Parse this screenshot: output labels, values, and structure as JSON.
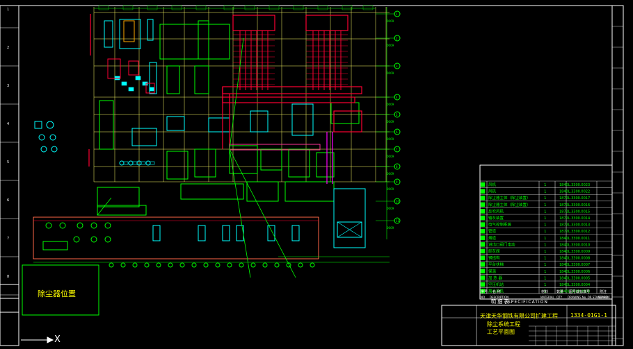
{
  "drawing": {
    "background": "#000000",
    "colors": {
      "frame": "#ffffff",
      "grid_line": "#ffff66",
      "column_bubble": "#00ff00",
      "equipment_cyan": "#00ffff",
      "equipment_green": "#00ff00",
      "piping_red": "#ff0033",
      "magenta": "#ff00ff",
      "leader": "#00ff00"
    }
  },
  "column_axes": {
    "right_bubbles": [
      "1",
      "2",
      "3",
      "4",
      "5",
      "6",
      "7",
      "8",
      "9",
      "10",
      "11"
    ],
    "left_strip_marks": [
      "1",
      "2",
      "3",
      "4",
      "5",
      "6",
      "7",
      "8"
    ]
  },
  "dust_remover_box": {
    "label": "除尘器位置"
  },
  "axis_indicator": {
    "label": "X"
  },
  "equipment_list": {
    "rows": [
      {
        "no": "17",
        "name": "风机",
        "qty": "1",
        "code": "1840L.3300.0023"
      },
      {
        "no": "16",
        "name": "风机",
        "qty": "1",
        "code": "1840L.3300.0022"
      },
      {
        "no": "15",
        "name": "除尘器主体（除尘装置）",
        "qty": "1",
        "code": "1872L.3300.0017"
      },
      {
        "no": "14",
        "name": "除尘器主体（除尘装置）",
        "qty": "1",
        "code": "1872L.3300.0016"
      },
      {
        "no": "13",
        "name": "反吹风机",
        "qty": "1",
        "code": "1872L.3300.0015"
      },
      {
        "no": "12",
        "name": "输灰装置",
        "qty": "1",
        "code": "1872L.3300.0014"
      },
      {
        "no": "11",
        "name": "电气控制系统",
        "qty": "1",
        "code": "1872L.3300.0013"
      },
      {
        "no": "10",
        "name": "管道",
        "qty": "1",
        "code": "1872L.3300.0012"
      },
      {
        "no": "9",
        "name": "烟道",
        "qty": "1",
        "code": "1840L.3300.0011"
      },
      {
        "no": "8",
        "name": "进出口阀门电动",
        "qty": "1",
        "code": "1840L.3300.0010"
      },
      {
        "no": "7",
        "name": "卸灰阀",
        "qty": "1",
        "code": "1840L.3300.0009"
      },
      {
        "no": "6",
        "name": "钢结构",
        "qty": "1",
        "code": "1840L.3300.0008"
      },
      {
        "no": "5",
        "name": "平台扶梯",
        "qty": "1",
        "code": "1840L.3300.0007"
      },
      {
        "no": "4",
        "name": "保温",
        "qty": "1",
        "code": "1840L.3300.0006"
      },
      {
        "no": "3",
        "name": "加 热 器",
        "qty": "1",
        "code": "1840L.3300.0005"
      },
      {
        "no": "2",
        "name": "空压机站",
        "qty": "1",
        "code": "1840L.3300.0004"
      },
      {
        "no": "1",
        "name": "离心风机",
        "qty": "1",
        "code": "1840L.3300.0003"
      }
    ],
    "header_cn": [
      "序号",
      "名 称",
      "材料",
      "数量",
      "图号或标准号",
      "附注"
    ],
    "header_en": [
      "NO",
      "DESCRIPTION",
      "MATERIAL",
      "QTY",
      "DRAWING No. OR STANDARD",
      "REMARK"
    ],
    "specification_label": "SPECIFICATION",
    "specification_cn": "明 细 表"
  },
  "title_block": {
    "company": "天津天华钢铁有限公司扩建工程",
    "drawing_no": "1334-01G1-1",
    "title_line1": "除尘系统工程",
    "title_line2": "工艺平面图"
  }
}
